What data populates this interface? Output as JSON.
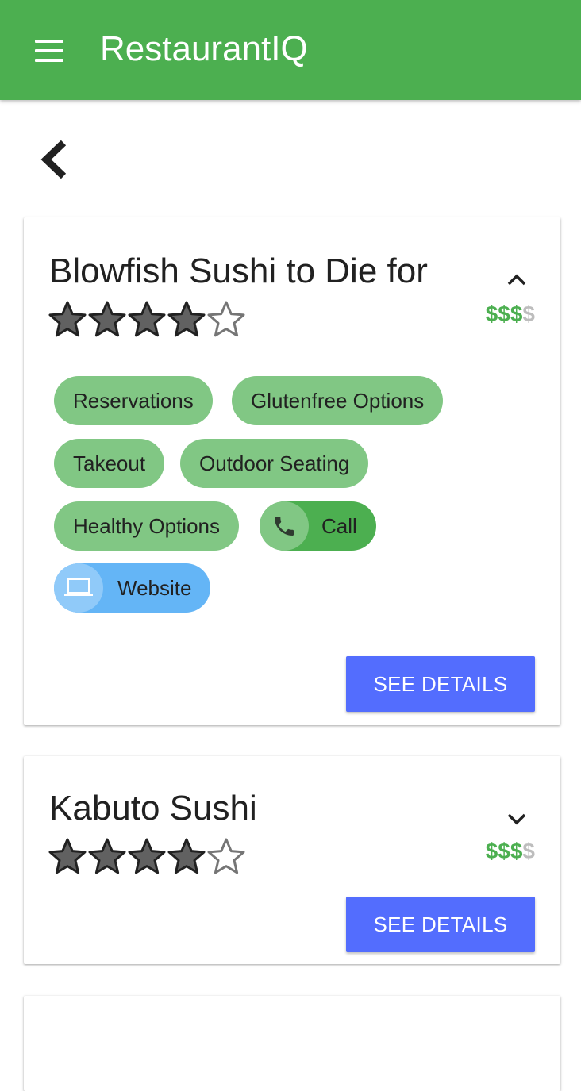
{
  "app": {
    "title": "RestaurantIQ"
  },
  "colors": {
    "primary": "#4caf50",
    "chip": "#81c784",
    "web_chip": "#64b5f6",
    "button": "#536dfe"
  },
  "nav": {
    "menu_icon": "menu-icon",
    "back_icon": "chevron-left-icon"
  },
  "restaurants": [
    {
      "name": "Blowfish Sushi to Die for",
      "rating": 4,
      "rating_max": 5,
      "price_on": "$$$",
      "price_off": "$",
      "expanded": true,
      "tags": [
        "Reservations",
        "Glutenfree Options",
        "Takeout",
        "Outdoor Seating",
        "Healthy Options"
      ],
      "call_label": "Call",
      "website_label": "Website",
      "details_label": "SEE DETAILS"
    },
    {
      "name": "Kabuto Sushi",
      "rating": 4,
      "rating_max": 5,
      "price_on": "$$$",
      "price_off": "$",
      "expanded": false,
      "details_label": "SEE DETAILS"
    }
  ]
}
